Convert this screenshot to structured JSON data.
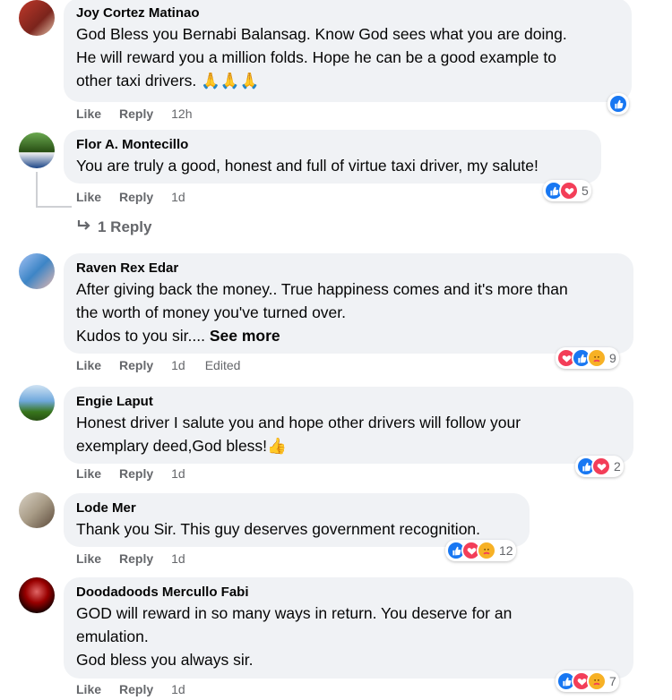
{
  "colors": {
    "like": "#1877f2",
    "love": "#f33e58",
    "care": "#f7b125",
    "bubble": "#f0f2f5",
    "meta": "#65676b"
  },
  "action_labels": {
    "like": "Like",
    "reply": "Reply"
  },
  "comments": [
    {
      "author": "Joy Cortez Matinao",
      "lines": [
        "God Bless you Bernabi Balansag. Know God sees what you are doing.",
        "He will reward you a million folds. Hope he can be a good example to",
        "other taxi drivers. 🙏🙏🙏"
      ],
      "time": "12h",
      "reactions": [
        "like-icon"
      ],
      "count": ""
    },
    {
      "author": "Flor A. Montecillo",
      "lines": [
        "You are truly a good, honest and full of virtue taxi driver, my salute!"
      ],
      "time": "1d",
      "reactions": [
        "like-icon",
        "love-icon"
      ],
      "count": "5",
      "reply_link": "1 Reply"
    },
    {
      "author": "Raven Rex Edar",
      "lines": [
        "After giving back the money.. True happiness comes and it's more than",
        "the worth of money you've turned over.",
        "Kudos to you sir...."
      ],
      "see_more": "See more",
      "time": "1d",
      "edited": "Edited",
      "reactions": [
        "love-icon",
        "like-icon",
        "care-icon"
      ],
      "count": "9"
    },
    {
      "author": "Engie Laput",
      "lines": [
        "Honest driver I salute you and hope other drivers will follow your",
        "exemplary deed,God bless!👍"
      ],
      "time": "1d",
      "reactions": [
        "like-icon",
        "love-icon"
      ],
      "count": "2"
    },
    {
      "author": "Lode Mer",
      "lines": [
        "Thank you Sir. This guy deserves government recognition."
      ],
      "time": "1d",
      "reactions": [
        "like-icon",
        "love-icon",
        "care-icon"
      ],
      "count": "12"
    },
    {
      "author": "Doodadoods Mercullo Fabi",
      "lines": [
        "GOD will reward in so many ways in return. You deserve for an",
        "emulation.",
        "God bless you always sir."
      ],
      "time": "1d",
      "reactions": [
        "like-icon",
        "love-icon",
        "care-icon"
      ],
      "count": "7"
    }
  ]
}
